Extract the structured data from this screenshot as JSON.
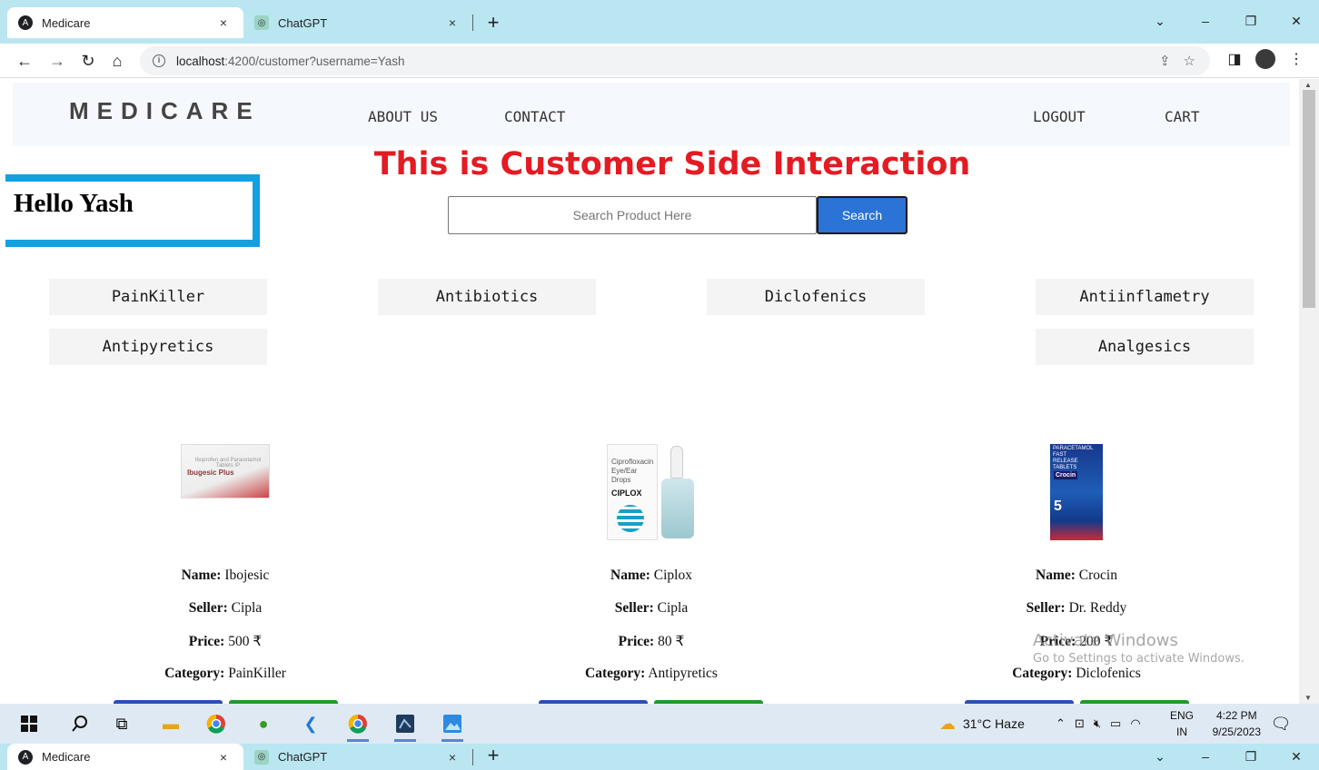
{
  "browser": {
    "tabs": [
      {
        "title": "Medicare",
        "active": true
      },
      {
        "title": "ChatGPT",
        "active": false
      }
    ],
    "new_tab": "+",
    "close_glyph": "×",
    "url_host": "localhost",
    "url_path": ":4200/customer?username=Yash",
    "window_controls": [
      "⌄",
      "–",
      "❐",
      "✕"
    ]
  },
  "site": {
    "brand": "MEDICARE",
    "nav": {
      "about": "ABOUT US",
      "contact": "CONTACT",
      "logout": "LOGOUT",
      "cart": "CART"
    },
    "heading": "This is Customer Side Interaction",
    "greeting": "Hello Yash",
    "search": {
      "placeholder": "Search Product Here",
      "button": "Search"
    },
    "categories": [
      "PainKiller",
      "Antibiotics",
      "Diclofenics",
      "Antiinflametry",
      "Antipyretics",
      "Analgesics"
    ],
    "labels": {
      "name": "Name:",
      "seller": "Seller:",
      "price": "Price:",
      "category": "Category:"
    },
    "products": [
      {
        "name": "Ibojesic",
        "seller": "Cipla",
        "price": "500 ₹",
        "category": "PainKiller",
        "image_text": "Ibugesic Plus"
      },
      {
        "name": "Ciplox",
        "seller": "Cipla",
        "price": "80 ₹",
        "category": "Antipyretics",
        "image_text": "CIPLOX"
      },
      {
        "name": "Crocin",
        "seller": "Dr. Reddy",
        "price": "200 ₹",
        "category": "Diclofenics",
        "image_text": "Crocin"
      }
    ],
    "button_colors": {
      "primary": "#2a4fb8",
      "secondary": "#1e9a2e"
    },
    "accent_heading": "#e31b23",
    "accent_box": "#12a0e0"
  },
  "watermark": {
    "line1": "Activate Windows",
    "line2": "Go to Settings to activate Windows."
  },
  "taskbar": {
    "weather": "31°C  Haze",
    "lang_top": "ENG",
    "lang_bottom": "IN",
    "time": "4:22 PM",
    "date": "9/25/2023"
  }
}
